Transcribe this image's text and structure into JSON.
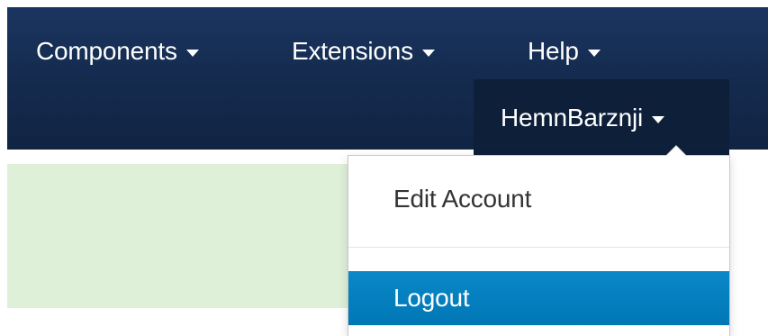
{
  "navbar": {
    "menus": [
      {
        "label": "Components"
      },
      {
        "label": "Extensions"
      },
      {
        "label": "Help"
      }
    ],
    "user": {
      "label": "HemnBarznji"
    }
  },
  "user_menu": {
    "items": [
      {
        "label": "Edit Account"
      },
      {
        "label": "Logout",
        "state": "highlighted"
      }
    ]
  },
  "colors": {
    "navbar": "#142a4d",
    "user_box": "#0e1f3a",
    "alert_bg": "#dff0d8",
    "highlight": "#0a88c8"
  }
}
